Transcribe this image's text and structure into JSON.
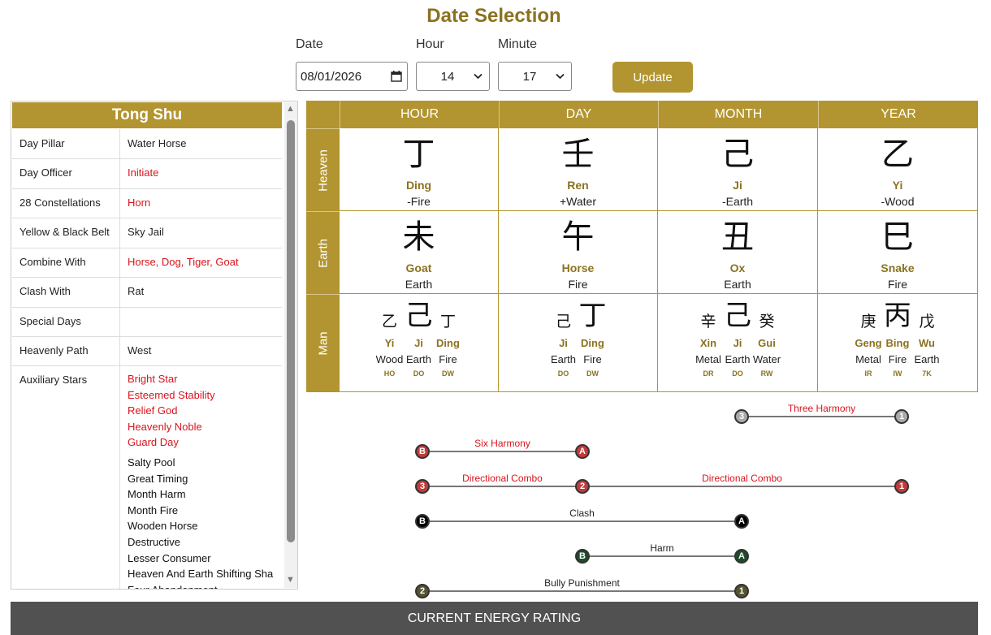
{
  "header": {
    "title": "Date Selection"
  },
  "form": {
    "date_label": "Date",
    "date_value": "08/01/2026",
    "hour_label": "Hour",
    "hour_value": "14",
    "minute_label": "Minute",
    "minute_value": "17",
    "update_label": "Update"
  },
  "tongshu": {
    "title": "Tong Shu",
    "rows": [
      {
        "key": "Day Pillar",
        "value": "Water Horse",
        "red": false
      },
      {
        "key": "Day Officer",
        "value": "Initiate",
        "red": true
      },
      {
        "key": "28 Constellations",
        "value": "Horn",
        "red": true
      },
      {
        "key": "Yellow & Black Belt",
        "value": "Sky Jail",
        "red": false
      },
      {
        "key": "Combine With",
        "value": "Horse, Dog, Tiger, Goat",
        "red": true
      },
      {
        "key": "Clash With",
        "value": "Rat",
        "red": false
      },
      {
        "key": "Special Days",
        "value": "",
        "red": false
      },
      {
        "key": "Heavenly Path",
        "value": "West",
        "red": false
      }
    ],
    "aux_label": "Auxiliary Stars",
    "aux_good": [
      "Bright Star",
      "Esteemed Stability",
      "Relief God",
      "Heavenly Noble",
      "Guard Day"
    ],
    "aux_bad": [
      "Salty Pool",
      "Great Timing",
      "Month Harm",
      "Month Fire",
      "Wooden Horse",
      "Destructive",
      "Lesser Consumer",
      "Heaven And Earth Shifting Sha",
      "Four Abandonment"
    ]
  },
  "pillars": {
    "columns": [
      "HOUR",
      "DAY",
      "MONTH",
      "YEAR"
    ],
    "rows": [
      "Heaven",
      "Earth",
      "Man"
    ],
    "heaven": [
      {
        "char": "丁",
        "name": "Ding",
        "element": "-Fire"
      },
      {
        "char": "壬",
        "name": "Ren",
        "element": "+Water"
      },
      {
        "char": "己",
        "name": "Ji",
        "element": "-Earth"
      },
      {
        "char": "乙",
        "name": "Yi",
        "element": "-Wood"
      }
    ],
    "earth": [
      {
        "char": "未",
        "name": "Goat",
        "element": "Earth"
      },
      {
        "char": "午",
        "name": "Horse",
        "element": "Fire"
      },
      {
        "char": "丑",
        "name": "Ox",
        "element": "Earth"
      },
      {
        "char": "巳",
        "name": "Snake",
        "element": "Fire"
      }
    ],
    "man": [
      [
        {
          "char": "乙",
          "name": "Yi",
          "element": "Wood",
          "god": "HO",
          "main": false
        },
        {
          "char": "己",
          "name": "Ji",
          "element": "Earth",
          "god": "DO",
          "main": true
        },
        {
          "char": "丁",
          "name": "Ding",
          "element": "Fire",
          "god": "DW",
          "main": false
        }
      ],
      [
        {
          "char": "己",
          "name": "Ji",
          "element": "Earth",
          "god": "DO",
          "main": false
        },
        {
          "char": "丁",
          "name": "Ding",
          "element": "Fire",
          "god": "DW",
          "main": true
        }
      ],
      [
        {
          "char": "辛",
          "name": "Xin",
          "element": "Metal",
          "god": "DR",
          "main": false
        },
        {
          "char": "己",
          "name": "Ji",
          "element": "Earth",
          "god": "DO",
          "main": true
        },
        {
          "char": "癸",
          "name": "Gui",
          "element": "Water",
          "god": "RW",
          "main": false
        }
      ],
      [
        {
          "char": "庚",
          "name": "Geng",
          "element": "Metal",
          "god": "IR",
          "main": false
        },
        {
          "char": "丙",
          "name": "Bing",
          "element": "Fire",
          "god": "IW",
          "main": true
        },
        {
          "char": "戊",
          "name": "Wu",
          "element": "Earth",
          "god": "7K",
          "main": false
        }
      ]
    ]
  },
  "relations": [
    {
      "label": "Three Harmony",
      "from": "3",
      "to": "1",
      "from_col": 2,
      "to_col": 3,
      "color": "#aaaaaa",
      "label_color": "#d8141c"
    },
    {
      "label": "Six Harmony",
      "from": "B",
      "to": "A",
      "from_col": 0,
      "to_col": 1,
      "color": "#c23b3b",
      "label_color": "#d8141c"
    },
    {
      "label": "Directional Combo",
      "from": "3",
      "to": "2",
      "from_col": 0,
      "to_col": 1,
      "color": "#c23b3b",
      "label_color": "#d8141c",
      "extra_label": "Directional Combo",
      "extra_to": "1",
      "extra_col": 3
    },
    {
      "label": "Clash",
      "from": "B",
      "to": "A",
      "from_col": 0,
      "to_col": 2,
      "color": "#000000",
      "label_color": "#222222"
    },
    {
      "label": "Harm",
      "from": "B",
      "to": "A",
      "from_col": 1,
      "to_col": 2,
      "color": "#1d4d2a",
      "label_color": "#222222"
    },
    {
      "label": "Bully Punishment",
      "from": "2",
      "to": "1",
      "from_col": 0,
      "to_col": 2,
      "color": "#57532f",
      "label_color": "#222222"
    }
  ],
  "footer": {
    "label": "CURRENT ENERGY RATING"
  },
  "colors": {
    "accent": "#b29530",
    "text_gold": "#8b7220",
    "red": "#d8141c",
    "footer": "#505150"
  },
  "icons": {
    "calendar": "calendar-icon",
    "dropdown": "chevron-down-icon",
    "scroll_up": "arrow-up-icon",
    "scroll_down": "arrow-down-icon"
  }
}
